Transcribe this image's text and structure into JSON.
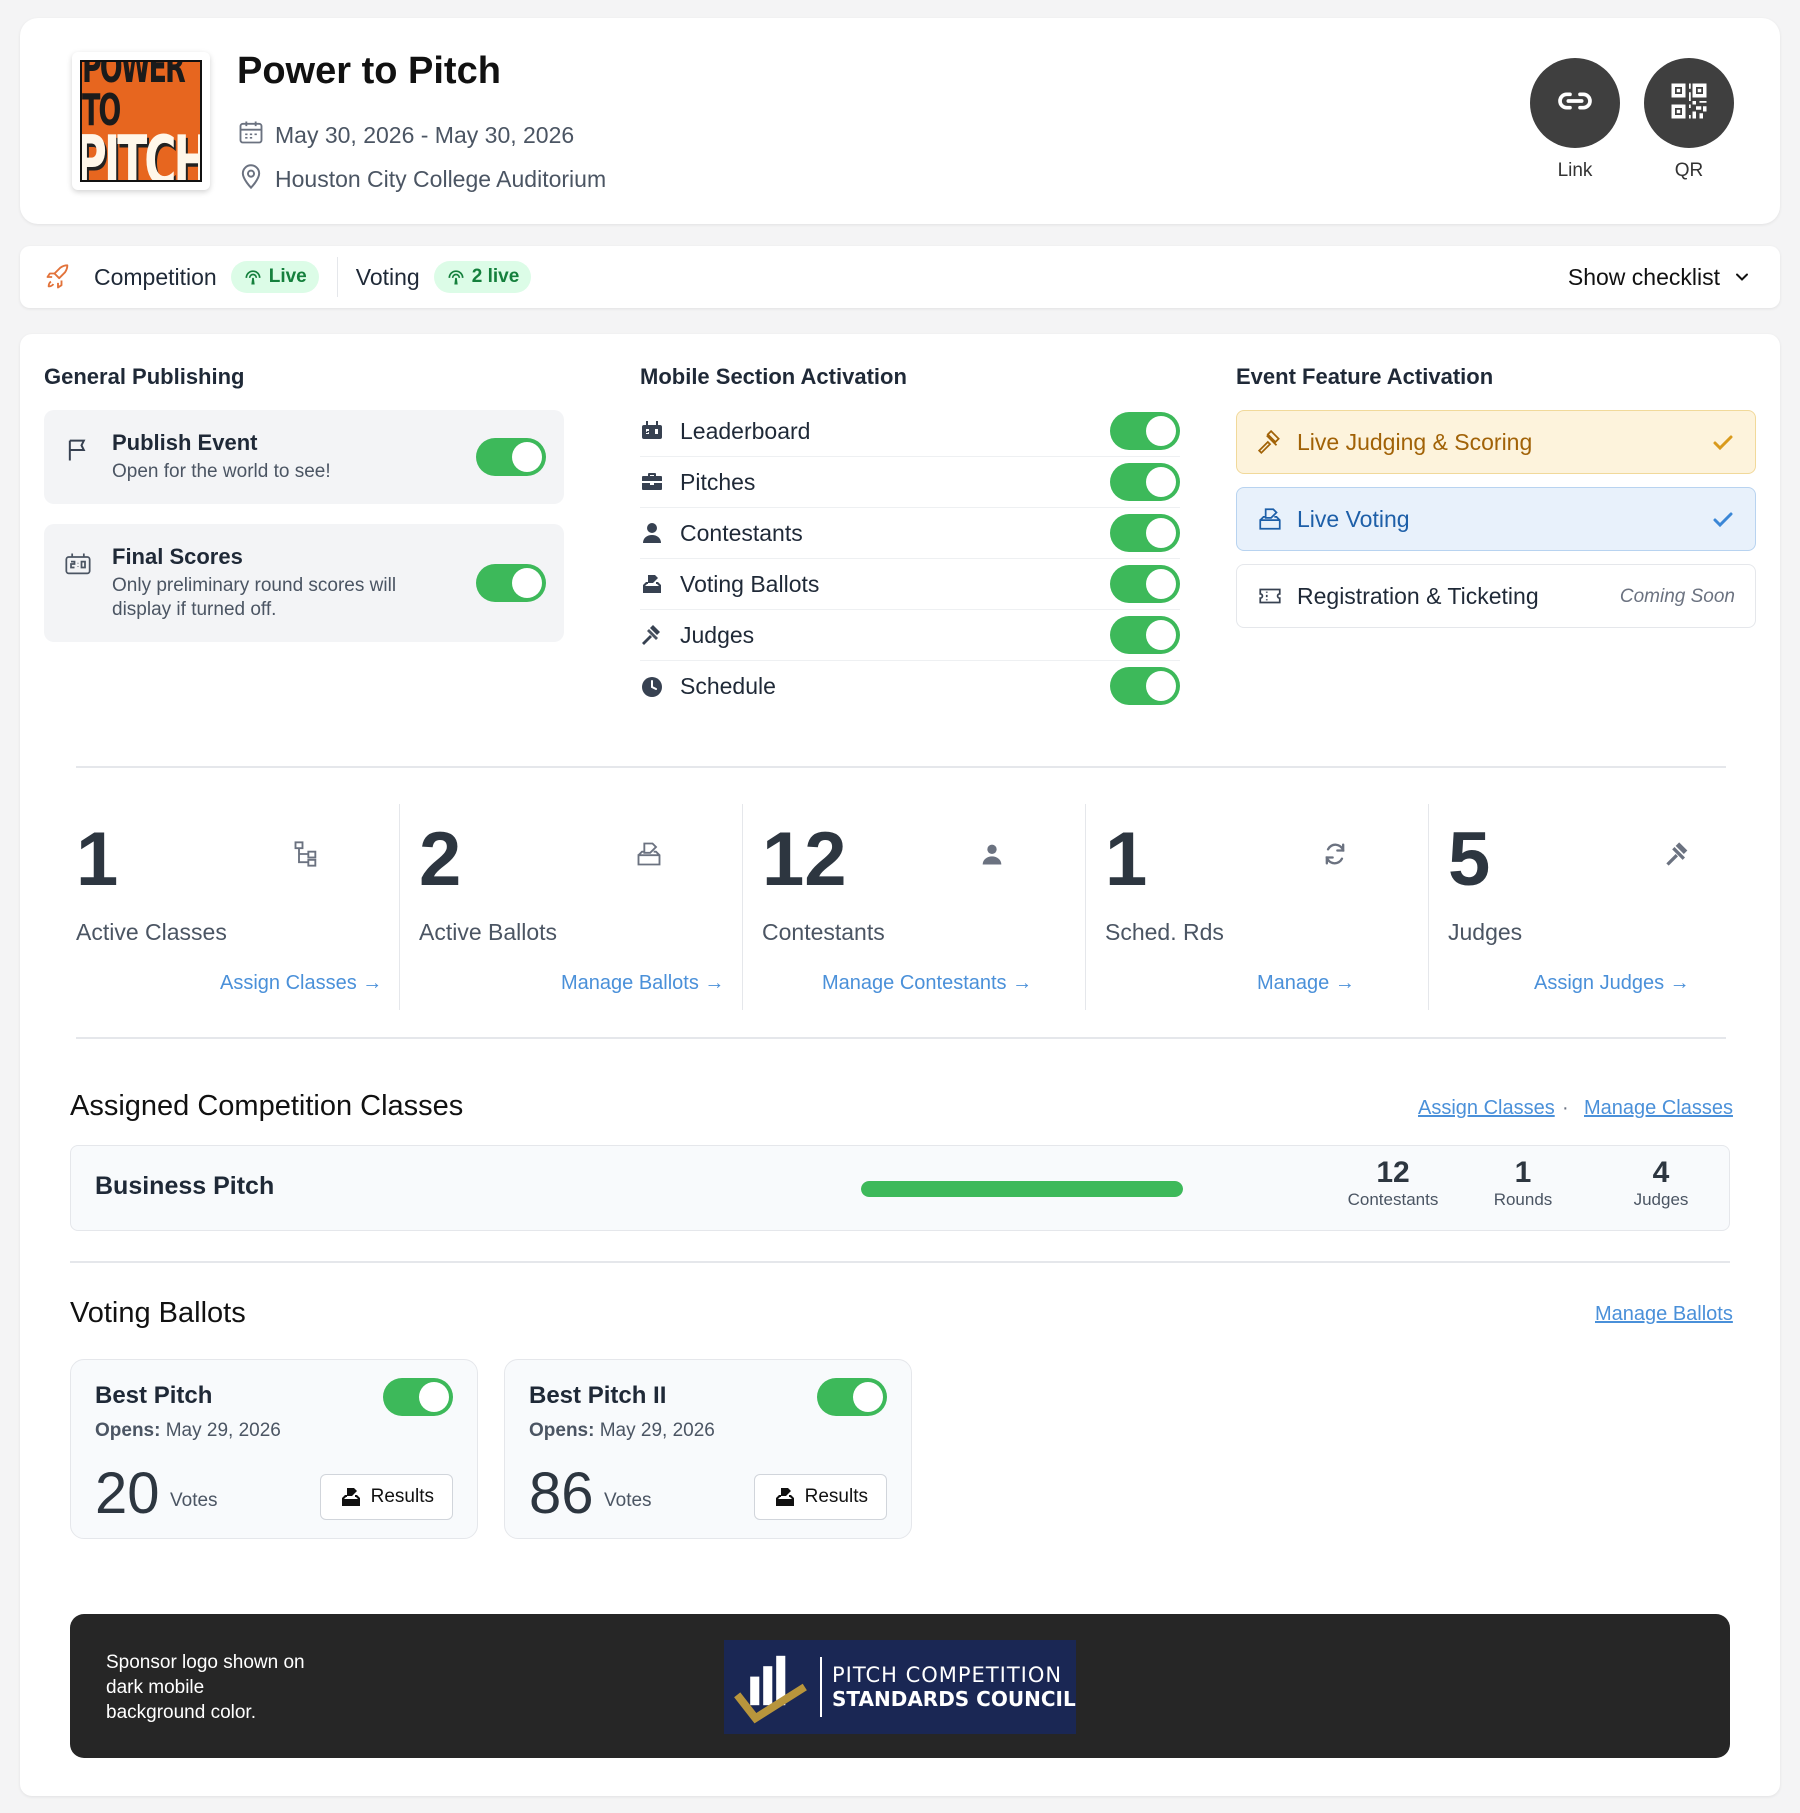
{
  "event": {
    "title": "Power to Pitch",
    "logo_text_top": "POWER TO",
    "logo_text_bottom": "PITCH",
    "date_range": "May 30, 2026 - May 30, 2026",
    "location": "Houston City College Auditorium"
  },
  "share": {
    "link_label": "Link",
    "qr_label": "QR"
  },
  "status": {
    "competition_label": "Competition",
    "competition_badge": "Live",
    "voting_label": "Voting",
    "voting_badge": "2 live",
    "checklist_label": "Show checklist"
  },
  "general_publishing": {
    "title": "General Publishing",
    "items": [
      {
        "title": "Publish Event",
        "description": "Open for the world to see!",
        "enabled": true
      },
      {
        "title": "Final Scores",
        "description": "Only preliminary round scores will display if turned off.",
        "enabled": true
      }
    ]
  },
  "mobile_sections": {
    "title": "Mobile Section Activation",
    "items": [
      {
        "label": "Leaderboard",
        "icon": "scoreboard-icon",
        "enabled": true
      },
      {
        "label": "Pitches",
        "icon": "briefcase-icon",
        "enabled": true
      },
      {
        "label": "Contestants",
        "icon": "person-icon",
        "enabled": true
      },
      {
        "label": "Voting Ballots",
        "icon": "ballot-box-icon",
        "enabled": true
      },
      {
        "label": "Judges",
        "icon": "gavel-icon",
        "enabled": true
      },
      {
        "label": "Schedule",
        "icon": "clock-icon",
        "enabled": true
      }
    ]
  },
  "event_features": {
    "title": "Event Feature Activation",
    "items": [
      {
        "label": "Live Judging & Scoring",
        "status": "active",
        "color": "#a16207",
        "bg": "#fdf3dc"
      },
      {
        "label": "Live Voting",
        "status": "active",
        "color": "#1d5fa8",
        "bg": "#e8f1fb"
      },
      {
        "label": "Registration & Ticketing",
        "status": "Coming Soon",
        "color": "#1f2937",
        "bg": "#ffffff"
      }
    ]
  },
  "stats": [
    {
      "value": "1",
      "label": "Active Classes",
      "link": "Assign Classes →",
      "icon": "hierarchy-icon"
    },
    {
      "value": "2",
      "label": "Active Ballots",
      "link": "Manage Ballots →",
      "icon": "ballot-box-icon"
    },
    {
      "value": "12",
      "label": "Contestants",
      "link": "Manage Contestants →",
      "icon": "person-icon"
    },
    {
      "value": "1",
      "label": "Sched. Rds",
      "link": "Manage →",
      "icon": "refresh-icon"
    },
    {
      "value": "5",
      "label": "Judges",
      "link": "Assign Judges →",
      "icon": "gavel-icon"
    }
  ],
  "classes": {
    "title": "Assigned Competition Classes",
    "assign_link": "Assign Classes",
    "separator": "·",
    "manage_link": "Manage Classes",
    "rows": [
      {
        "name": "Business Pitch",
        "progress": 1.0,
        "contestants_value": "12",
        "contestants_label": "Contestants",
        "rounds_value": "1",
        "rounds_label": "Rounds",
        "judges_value": "4",
        "judges_label": "Judges"
      }
    ]
  },
  "ballots": {
    "title": "Voting Ballots",
    "manage_link": "Manage Ballots",
    "opens_label": "Opens:",
    "votes_label": "Votes",
    "results_label": "Results",
    "items": [
      {
        "name": "Best Pitch",
        "opens": "May 29, 2026",
        "votes": "20",
        "enabled": true
      },
      {
        "name": "Best Pitch II",
        "opens": "May 29, 2026",
        "votes": "86",
        "enabled": true
      }
    ]
  },
  "sponsor": {
    "note": "Sponsor logo shown on dark mobile background color.",
    "logo_line1": "PITCH COMPETITION",
    "logo_line2": "STANDARDS COUNCIL"
  },
  "colors": {
    "toggle_on": "#3db95a",
    "link": "#4a90d9",
    "badge_green": "#15803d",
    "dark_button": "#3f3f3f"
  }
}
